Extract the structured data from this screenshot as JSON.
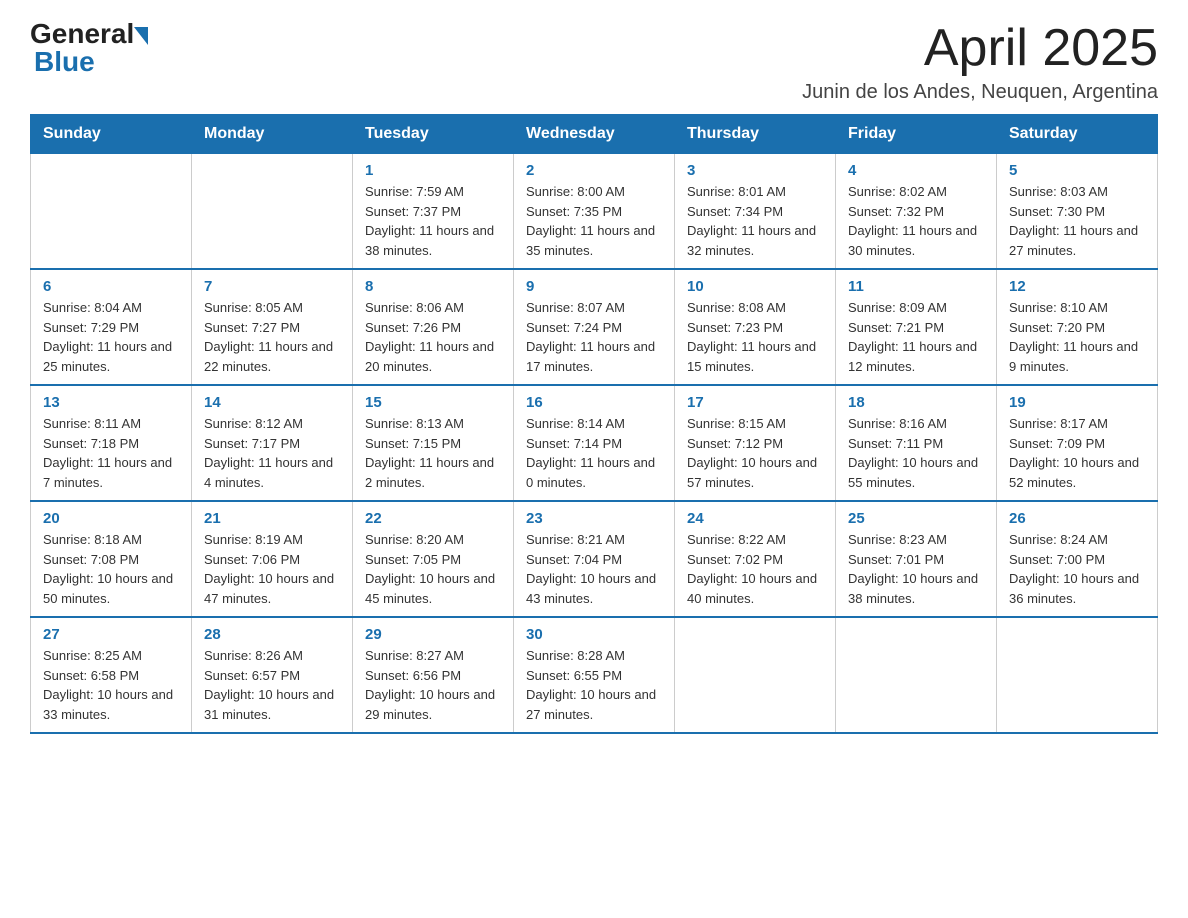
{
  "header": {
    "logo_general": "General",
    "logo_blue": "Blue",
    "month_title": "April 2025",
    "location": "Junin de los Andes, Neuquen, Argentina"
  },
  "days_of_week": [
    "Sunday",
    "Monday",
    "Tuesday",
    "Wednesday",
    "Thursday",
    "Friday",
    "Saturday"
  ],
  "weeks": [
    [
      {
        "day": "",
        "info": ""
      },
      {
        "day": "",
        "info": ""
      },
      {
        "day": "1",
        "info": "Sunrise: 7:59 AM\nSunset: 7:37 PM\nDaylight: 11 hours and 38 minutes."
      },
      {
        "day": "2",
        "info": "Sunrise: 8:00 AM\nSunset: 7:35 PM\nDaylight: 11 hours and 35 minutes."
      },
      {
        "day": "3",
        "info": "Sunrise: 8:01 AM\nSunset: 7:34 PM\nDaylight: 11 hours and 32 minutes."
      },
      {
        "day": "4",
        "info": "Sunrise: 8:02 AM\nSunset: 7:32 PM\nDaylight: 11 hours and 30 minutes."
      },
      {
        "day": "5",
        "info": "Sunrise: 8:03 AM\nSunset: 7:30 PM\nDaylight: 11 hours and 27 minutes."
      }
    ],
    [
      {
        "day": "6",
        "info": "Sunrise: 8:04 AM\nSunset: 7:29 PM\nDaylight: 11 hours and 25 minutes."
      },
      {
        "day": "7",
        "info": "Sunrise: 8:05 AM\nSunset: 7:27 PM\nDaylight: 11 hours and 22 minutes."
      },
      {
        "day": "8",
        "info": "Sunrise: 8:06 AM\nSunset: 7:26 PM\nDaylight: 11 hours and 20 minutes."
      },
      {
        "day": "9",
        "info": "Sunrise: 8:07 AM\nSunset: 7:24 PM\nDaylight: 11 hours and 17 minutes."
      },
      {
        "day": "10",
        "info": "Sunrise: 8:08 AM\nSunset: 7:23 PM\nDaylight: 11 hours and 15 minutes."
      },
      {
        "day": "11",
        "info": "Sunrise: 8:09 AM\nSunset: 7:21 PM\nDaylight: 11 hours and 12 minutes."
      },
      {
        "day": "12",
        "info": "Sunrise: 8:10 AM\nSunset: 7:20 PM\nDaylight: 11 hours and 9 minutes."
      }
    ],
    [
      {
        "day": "13",
        "info": "Sunrise: 8:11 AM\nSunset: 7:18 PM\nDaylight: 11 hours and 7 minutes."
      },
      {
        "day": "14",
        "info": "Sunrise: 8:12 AM\nSunset: 7:17 PM\nDaylight: 11 hours and 4 minutes."
      },
      {
        "day": "15",
        "info": "Sunrise: 8:13 AM\nSunset: 7:15 PM\nDaylight: 11 hours and 2 minutes."
      },
      {
        "day": "16",
        "info": "Sunrise: 8:14 AM\nSunset: 7:14 PM\nDaylight: 11 hours and 0 minutes."
      },
      {
        "day": "17",
        "info": "Sunrise: 8:15 AM\nSunset: 7:12 PM\nDaylight: 10 hours and 57 minutes."
      },
      {
        "day": "18",
        "info": "Sunrise: 8:16 AM\nSunset: 7:11 PM\nDaylight: 10 hours and 55 minutes."
      },
      {
        "day": "19",
        "info": "Sunrise: 8:17 AM\nSunset: 7:09 PM\nDaylight: 10 hours and 52 minutes."
      }
    ],
    [
      {
        "day": "20",
        "info": "Sunrise: 8:18 AM\nSunset: 7:08 PM\nDaylight: 10 hours and 50 minutes."
      },
      {
        "day": "21",
        "info": "Sunrise: 8:19 AM\nSunset: 7:06 PM\nDaylight: 10 hours and 47 minutes."
      },
      {
        "day": "22",
        "info": "Sunrise: 8:20 AM\nSunset: 7:05 PM\nDaylight: 10 hours and 45 minutes."
      },
      {
        "day": "23",
        "info": "Sunrise: 8:21 AM\nSunset: 7:04 PM\nDaylight: 10 hours and 43 minutes."
      },
      {
        "day": "24",
        "info": "Sunrise: 8:22 AM\nSunset: 7:02 PM\nDaylight: 10 hours and 40 minutes."
      },
      {
        "day": "25",
        "info": "Sunrise: 8:23 AM\nSunset: 7:01 PM\nDaylight: 10 hours and 38 minutes."
      },
      {
        "day": "26",
        "info": "Sunrise: 8:24 AM\nSunset: 7:00 PM\nDaylight: 10 hours and 36 minutes."
      }
    ],
    [
      {
        "day": "27",
        "info": "Sunrise: 8:25 AM\nSunset: 6:58 PM\nDaylight: 10 hours and 33 minutes."
      },
      {
        "day": "28",
        "info": "Sunrise: 8:26 AM\nSunset: 6:57 PM\nDaylight: 10 hours and 31 minutes."
      },
      {
        "day": "29",
        "info": "Sunrise: 8:27 AM\nSunset: 6:56 PM\nDaylight: 10 hours and 29 minutes."
      },
      {
        "day": "30",
        "info": "Sunrise: 8:28 AM\nSunset: 6:55 PM\nDaylight: 10 hours and 27 minutes."
      },
      {
        "day": "",
        "info": ""
      },
      {
        "day": "",
        "info": ""
      },
      {
        "day": "",
        "info": ""
      }
    ]
  ]
}
